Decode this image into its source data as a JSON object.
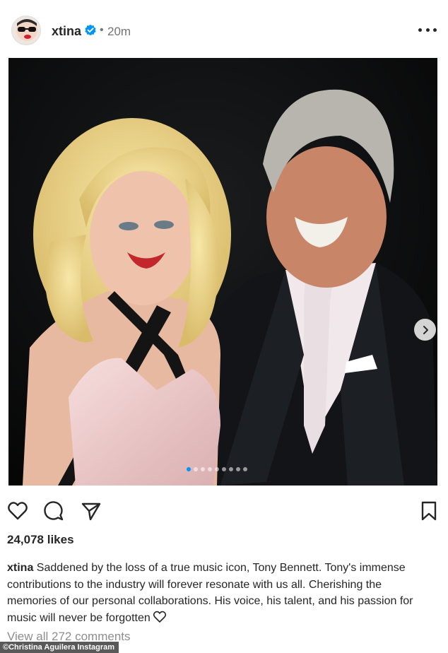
{
  "post": {
    "username": "xtina",
    "separator": "•",
    "time": "20m",
    "verified": true,
    "colors": {
      "verified": "#0095f6",
      "accent": "#0095f6"
    }
  },
  "media": {
    "carousel_count": 9,
    "active_index": 0,
    "next_icon": "chevron-right-icon"
  },
  "actions": {
    "icons": [
      "heart-icon",
      "comment-icon",
      "share-icon",
      "bookmark-icon"
    ]
  },
  "likes": "24,078 likes",
  "caption": {
    "username": "xtina",
    "text": "Saddened by the loss of a true music icon, Tony Bennett. Tony's immense contributions to the industry will forever resonate with us all. Cherishing the memories of our personal collaborations. His voice, his talent, and his passion for music will never be forgotten",
    "emoji_icon": "heart-outline-icon"
  },
  "comments": {
    "view_all": "View all 272 comments"
  },
  "watermark": "©Christina Aguilera Instagram"
}
